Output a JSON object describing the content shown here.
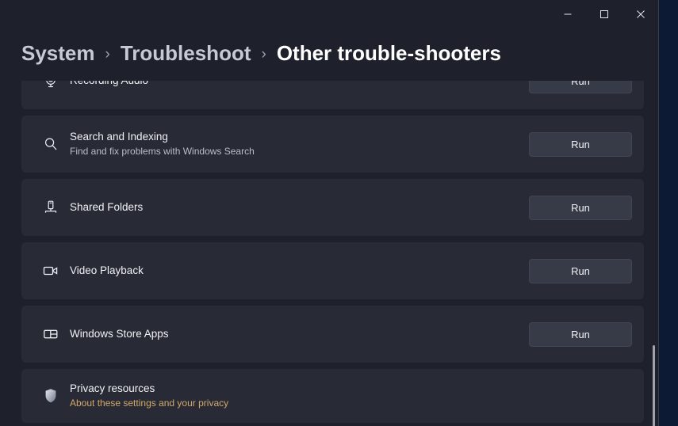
{
  "window": {
    "controls": [
      {
        "name": "minimize",
        "label": "Minimize"
      },
      {
        "name": "maximize",
        "label": "Maximize"
      },
      {
        "name": "close",
        "label": "Close"
      }
    ]
  },
  "breadcrumb": {
    "items": [
      "System",
      "Troubleshoot",
      "Other trouble-shooters"
    ],
    "separator": "›",
    "current_index": 2
  },
  "colors": {
    "page_background": "#1e212b",
    "card_background": "#282b36",
    "button_background": "#373b47",
    "link_accent": "#d3a86b",
    "text_primary": "#f0f1f5",
    "text_secondary": "#b9bdc8",
    "breadcrumb_inactive": "#c6cad4",
    "scrollbar_thumb": "#9ea3ad"
  },
  "troubleshooters": [
    {
      "icon": "microphone-icon",
      "title": "Recording Audio",
      "subtitle": "",
      "action_label": "Run"
    },
    {
      "icon": "search-icon",
      "title": "Search and Indexing",
      "subtitle": "Find and fix problems with Windows Search",
      "action_label": "Run"
    },
    {
      "icon": "shared-folders-icon",
      "title": "Shared Folders",
      "subtitle": "",
      "action_label": "Run"
    },
    {
      "icon": "video-camera-icon",
      "title": "Video Playback",
      "subtitle": "",
      "action_label": "Run"
    },
    {
      "icon": "store-apps-icon",
      "title": "Windows Store Apps",
      "subtitle": "",
      "action_label": "Run"
    }
  ],
  "privacy": {
    "icon": "shield-icon",
    "title": "Privacy resources",
    "link_label": "About these settings and your privacy"
  }
}
